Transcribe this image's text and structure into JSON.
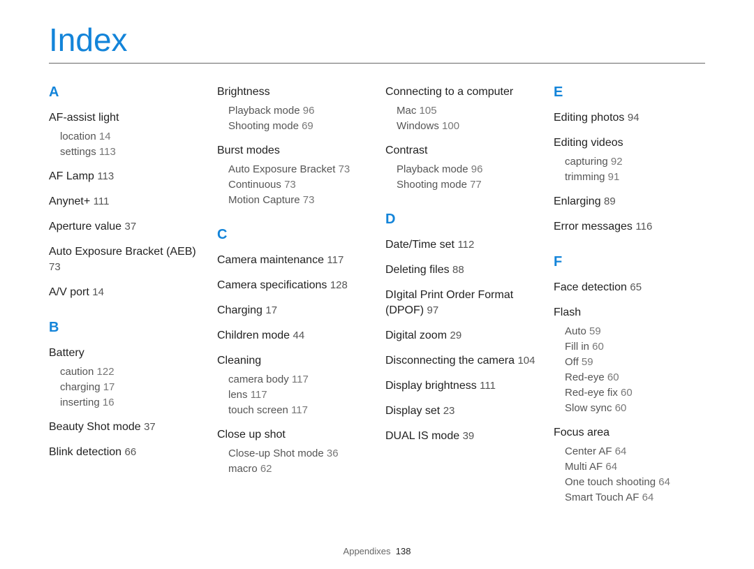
{
  "title": "Index",
  "footer": {
    "section": "Appendixes",
    "page": "138"
  },
  "chart_data": null,
  "columns": [
    {
      "groups": [
        {
          "letter": "A",
          "items": [
            {
              "term": "AF-assist light",
              "page": "",
              "subs": [
                {
                  "label": "location",
                  "page": "14"
                },
                {
                  "label": "settings",
                  "page": "113"
                }
              ]
            },
            {
              "term": "AF Lamp",
              "page": "113"
            },
            {
              "term": "Anynet+",
              "page": "111"
            },
            {
              "term": "Aperture value",
              "page": "37"
            },
            {
              "term": "Auto Exposure Bracket (AEB)",
              "page": "73"
            },
            {
              "term": "A/V port",
              "page": "14"
            }
          ]
        },
        {
          "letter": "B",
          "items": [
            {
              "term": "Battery",
              "page": "",
              "subs": [
                {
                  "label": "caution",
                  "page": "122"
                },
                {
                  "label": "charging",
                  "page": "17"
                },
                {
                  "label": "inserting",
                  "page": "16"
                }
              ]
            },
            {
              "term": "Beauty Shot mode",
              "page": "37"
            },
            {
              "term": "Blink detection",
              "page": "66"
            }
          ]
        }
      ]
    },
    {
      "groups": [
        {
          "letter": "",
          "items": [
            {
              "term": "Brightness",
              "page": "",
              "subs": [
                {
                  "label": "Playback mode",
                  "page": "96"
                },
                {
                  "label": "Shooting mode",
                  "page": "69"
                }
              ]
            },
            {
              "term": "Burst modes",
              "page": "",
              "subs": [
                {
                  "label": "Auto Exposure Bracket",
                  "page": "73"
                },
                {
                  "label": "Continuous",
                  "page": "73"
                },
                {
                  "label": "Motion Capture",
                  "page": "73"
                }
              ]
            }
          ]
        },
        {
          "letter": "C",
          "items": [
            {
              "term": "Camera maintenance",
              "page": "117"
            },
            {
              "term": "Camera specifications",
              "page": "128"
            },
            {
              "term": "Charging",
              "page": "17"
            },
            {
              "term": "Children mode",
              "page": "44"
            },
            {
              "term": "Cleaning",
              "page": "",
              "subs": [
                {
                  "label": "camera body",
                  "page": "117"
                },
                {
                  "label": "lens",
                  "page": "117"
                },
                {
                  "label": "touch screen",
                  "page": "117"
                }
              ]
            },
            {
              "term": "Close up shot",
              "page": "",
              "subs": [
                {
                  "label": "Close-up Shot mode",
                  "page": "36"
                },
                {
                  "label": "macro",
                  "page": "62"
                }
              ]
            }
          ]
        }
      ]
    },
    {
      "groups": [
        {
          "letter": "",
          "items": [
            {
              "term": "Connecting to a computer",
              "page": "",
              "subs": [
                {
                  "label": "Mac",
                  "page": "105"
                },
                {
                  "label": "Windows",
                  "page": "100"
                }
              ]
            },
            {
              "term": "Contrast",
              "page": "",
              "subs": [
                {
                  "label": "Playback mode",
                  "page": "96"
                },
                {
                  "label": "Shooting mode",
                  "page": "77"
                }
              ]
            }
          ]
        },
        {
          "letter": "D",
          "items": [
            {
              "term": "Date/Time set",
              "page": "112"
            },
            {
              "term": "Deleting files",
              "page": "88"
            },
            {
              "term": "DIgital Print Order Format (DPOF)",
              "page": "97"
            },
            {
              "term": "Digital zoom",
              "page": "29"
            },
            {
              "term": "Disconnecting the camera",
              "page": "104"
            },
            {
              "term": "Display brightness",
              "page": "111"
            },
            {
              "term": "Display set",
              "page": "23"
            },
            {
              "term": "DUAL IS mode",
              "page": "39"
            }
          ]
        }
      ]
    },
    {
      "groups": [
        {
          "letter": "E",
          "items": [
            {
              "term": "Editing photos",
              "page": "94"
            },
            {
              "term": "Editing videos",
              "page": "",
              "subs": [
                {
                  "label": "capturing",
                  "page": "92"
                },
                {
                  "label": "trimming",
                  "page": "91"
                }
              ]
            },
            {
              "term": "Enlarging",
              "page": "89"
            },
            {
              "term": "Error messages",
              "page": "116"
            }
          ]
        },
        {
          "letter": "F",
          "items": [
            {
              "term": "Face detection",
              "page": "65"
            },
            {
              "term": "Flash",
              "page": "",
              "subs": [
                {
                  "label": "Auto",
                  "page": "59"
                },
                {
                  "label": "Fill in",
                  "page": "60"
                },
                {
                  "label": "Off",
                  "page": "59"
                },
                {
                  "label": "Red-eye",
                  "page": "60"
                },
                {
                  "label": "Red-eye fix",
                  "page": "60"
                },
                {
                  "label": "Slow sync",
                  "page": "60"
                }
              ]
            },
            {
              "term": "Focus area",
              "page": "",
              "subs": [
                {
                  "label": "Center AF",
                  "page": "64"
                },
                {
                  "label": "Multi AF",
                  "page": "64"
                },
                {
                  "label": "One touch shooting",
                  "page": "64"
                },
                {
                  "label": "Smart Touch AF",
                  "page": "64"
                }
              ]
            }
          ]
        }
      ]
    }
  ]
}
